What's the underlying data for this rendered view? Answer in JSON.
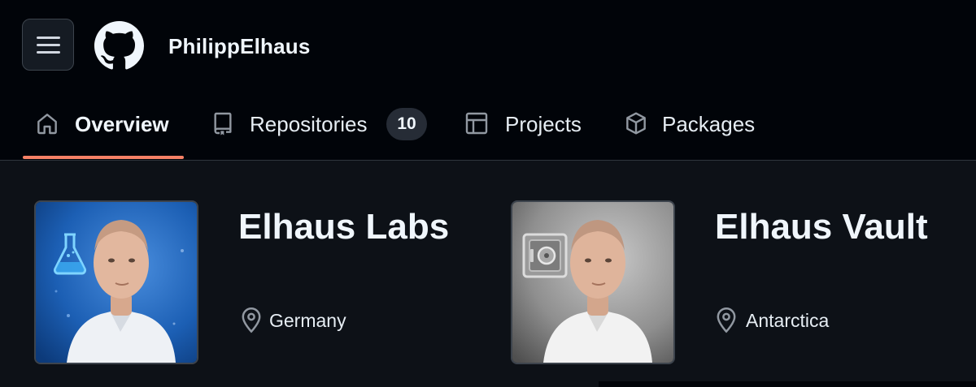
{
  "header": {
    "username": "PhilippElhaus",
    "menu_icon": "hamburger-icon",
    "logo_icon": "github-octocat-icon"
  },
  "tabs": [
    {
      "label": "Overview",
      "icon": "home-icon",
      "active": true
    },
    {
      "label": "Repositories",
      "icon": "repo-icon",
      "count": "10"
    },
    {
      "label": "Projects",
      "icon": "table-icon"
    },
    {
      "label": "Packages",
      "icon": "package-icon"
    }
  ],
  "cards": [
    {
      "title": "Elhaus Labs",
      "location": "Germany",
      "avatar_icon": "flask-icon",
      "avatar_theme": "blue"
    },
    {
      "title": "Elhaus Vault",
      "location": "Antarctica",
      "avatar_icon": "vault-safe-icon",
      "avatar_theme": "silver"
    }
  ],
  "colors": {
    "header_bg": "#010409",
    "page_bg": "#0d1117",
    "active_underline": "#f78166",
    "text": "#e6edf3"
  }
}
